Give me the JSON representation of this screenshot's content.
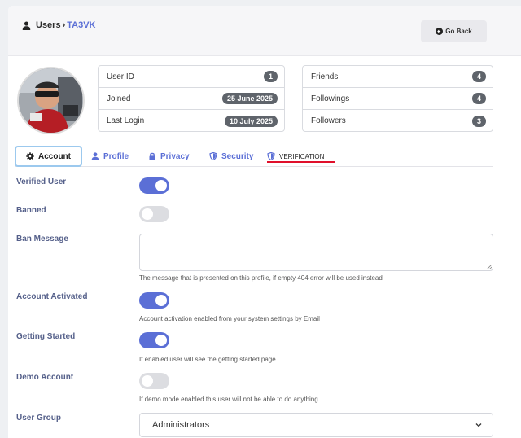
{
  "breadcrumb": {
    "section": "Users",
    "separator": "›",
    "current": "TA3VK"
  },
  "header": {
    "go_back_label": "Go Back"
  },
  "stats_left": [
    {
      "label": "User ID",
      "value": "1"
    },
    {
      "label": "Joined",
      "value": "25 June 2025"
    },
    {
      "label": "Last Login",
      "value": "10 July 2025"
    }
  ],
  "stats_right": [
    {
      "label": "Friends",
      "value": "4"
    },
    {
      "label": "Followings",
      "value": "4"
    },
    {
      "label": "Followers",
      "value": "3"
    }
  ],
  "tabs": [
    {
      "label": "Account",
      "icon": "gear-icon",
      "active": true
    },
    {
      "label": "Profile",
      "icon": "user-icon"
    },
    {
      "label": "Privacy",
      "icon": "lock-icon"
    },
    {
      "label": "Security",
      "icon": "shield-icon"
    },
    {
      "label": "VERIFICATION",
      "icon": "shield-icon"
    }
  ],
  "form": {
    "verified_user": {
      "label": "Verified User",
      "on": true
    },
    "banned": {
      "label": "Banned",
      "on": false
    },
    "ban_message": {
      "label": "Ban Message",
      "value": "",
      "help": "The message that is presented on this profile, if empty 404 error will be used instead"
    },
    "account_activated": {
      "label": "Account Activated",
      "on": true,
      "help": "Account activation enabled from your system settings by Email"
    },
    "getting_started": {
      "label": "Getting Started",
      "on": true,
      "help": "If enabled user will see the getting started page"
    },
    "demo_account": {
      "label": "Demo Account",
      "on": false,
      "help": "If demo mode enabled this user will not be able to do anything"
    },
    "user_group": {
      "label": "User Group",
      "selected": "Administrators"
    }
  },
  "colors": {
    "accent": "#5b6fd6",
    "pill": "#5f646b",
    "underline": "#e0102b",
    "label": "#55608a"
  }
}
